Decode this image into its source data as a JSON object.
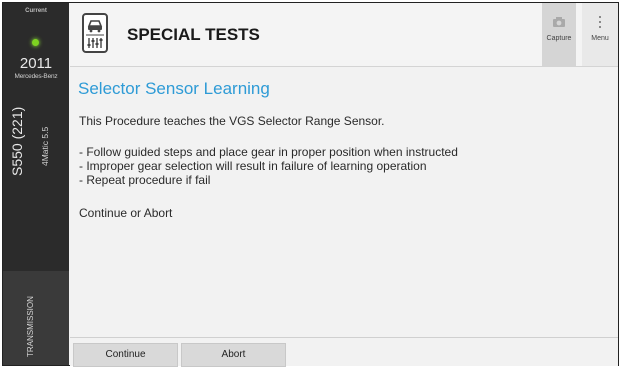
{
  "sidebar": {
    "current_label": "Current",
    "status_color": "#7ed321",
    "year": "2011",
    "make": "Mercedes-Benz",
    "model": "S550 (221)",
    "trim": "4Matic 5.5",
    "module": "TRANSMISSION"
  },
  "header": {
    "icon": "vehicle-tests-icon",
    "title": "SPECIAL TESTS",
    "capture_label": "Capture",
    "menu_label": "Menu"
  },
  "procedure": {
    "title": "Selector Sensor Learning",
    "title_color": "#2e9bd6",
    "description": "This Procedure teaches the VGS Selector Range Sensor.",
    "steps": [
      "- Follow guided steps and place gear in proper position when instructed",
      "- Improper gear selection will result in failure of learning operation",
      "- Repeat procedure if fail"
    ],
    "prompt": "Continue or Abort"
  },
  "footer": {
    "continue_label": "Continue",
    "abort_label": "Abort"
  }
}
